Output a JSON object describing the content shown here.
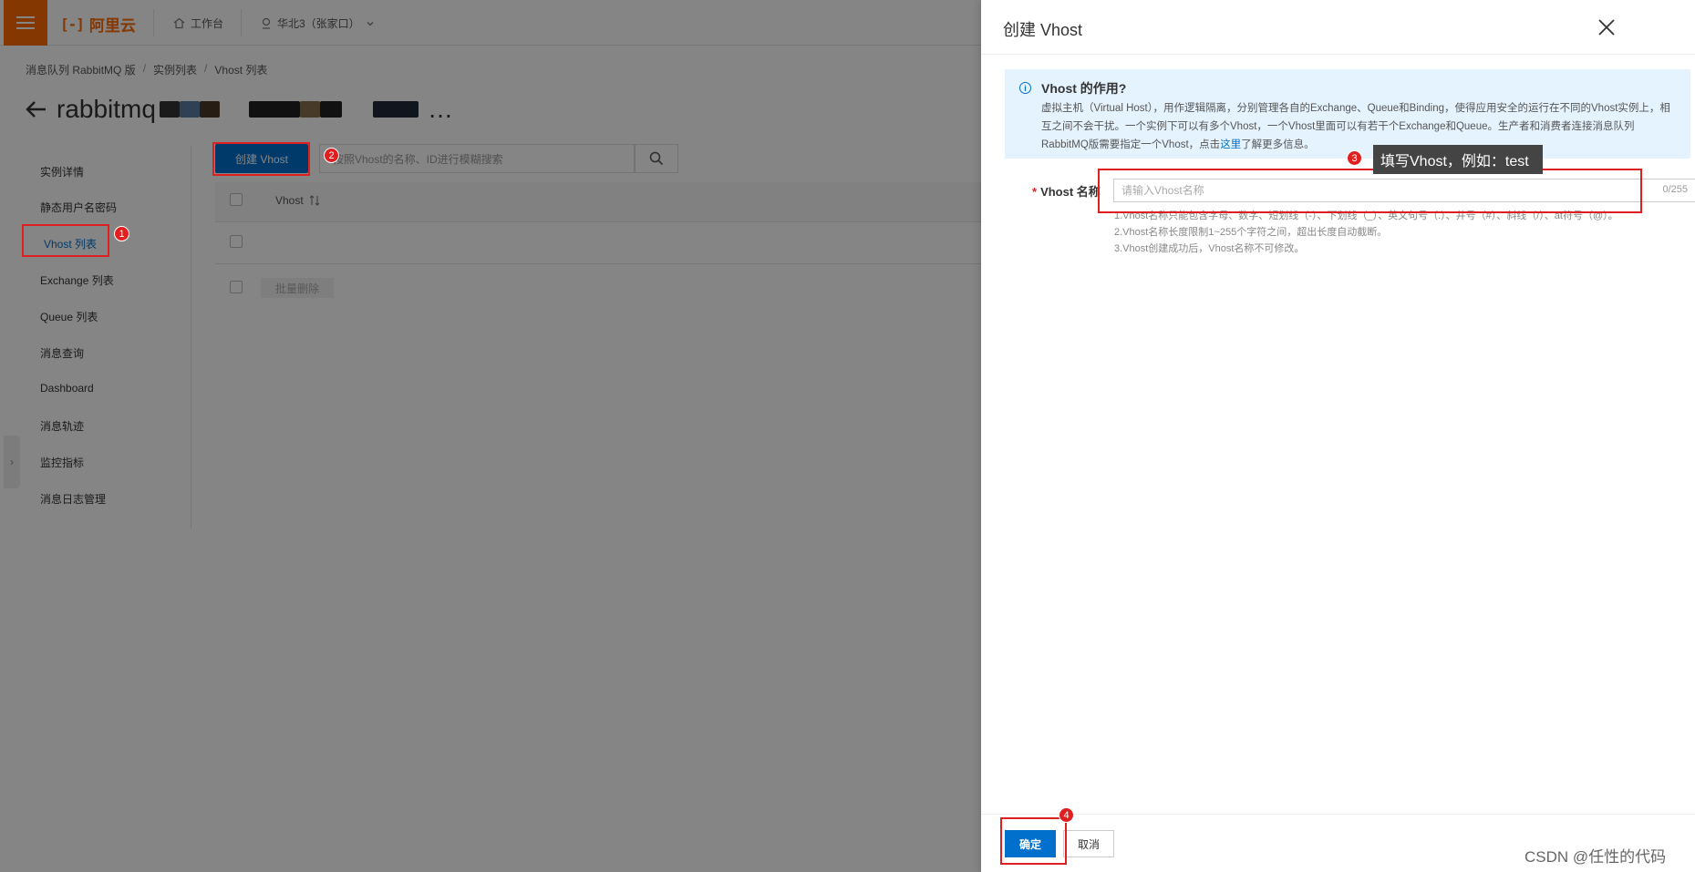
{
  "console": {
    "brand": "阿里云",
    "workbench_label": "工作台",
    "region_label": "华北3（张家口）",
    "breadcrumb": [
      "消息队列 RabbitMQ 版",
      "实例列表",
      "Vhost 列表"
    ],
    "page_title": "rabbitmq",
    "page_title_suffix": "…",
    "nav_items": [
      "实例详情",
      "静态用户名密码",
      "Vhost 列表",
      "Exchange 列表",
      "Queue 列表",
      "消息查询",
      "Dashboard",
      "消息轨迹",
      "监控指标",
      "消息日志管理"
    ],
    "create_button_label": "创建 Vhost",
    "search_placeholder": "按照Vhost的名称、ID进行模糊搜索",
    "column_vhost": "Vhost",
    "batch_delete_label": "批量删除"
  },
  "drawer": {
    "title": "创建 Vhost",
    "info_title": "Vhost 的作用?",
    "info_text_1": "虚拟主机（Virtual Host），用作逻辑隔离，分别管理各自的Exchange、Queue和Binding，使得应用安全的运行在不同的Vhost实例上，相互之间不会干扰。一个实例下可以有多个Vhost，一个Vhost里面可以有若干个Exchange和Queue。生产者和消费者连接消息队列RabbitMQ版需要指定一个Vhost，点击",
    "info_link": "这里",
    "info_text_2": "了解更多信息。",
    "field_label": "Vhost 名称",
    "field_placeholder": "请输入Vhost名称",
    "field_value": "",
    "char_count": "0/255",
    "hints": [
      "1.Vhost名称只能包含字母、数字、短划线（-）、下划线（_）、英文句号（.）、井号（#）、斜线（/）、at符号（@）。",
      "2.Vhost名称长度限制1~255个字符之间，超出长度自动截断。",
      "3.Vhost创建成功后，Vhost名称不可修改。"
    ],
    "ok_label": "确定",
    "cancel_label": "取消"
  },
  "annotations": {
    "step1": "1",
    "step2": "2",
    "step3": "3",
    "step4": "4",
    "tooltip": "填写Vhost，例如：test"
  },
  "watermark": "CSDN @任性的代码",
  "colors": {
    "brand_orange": "#ff6a00",
    "primary_blue": "#0070cc",
    "annotation_red": "#e02020"
  }
}
